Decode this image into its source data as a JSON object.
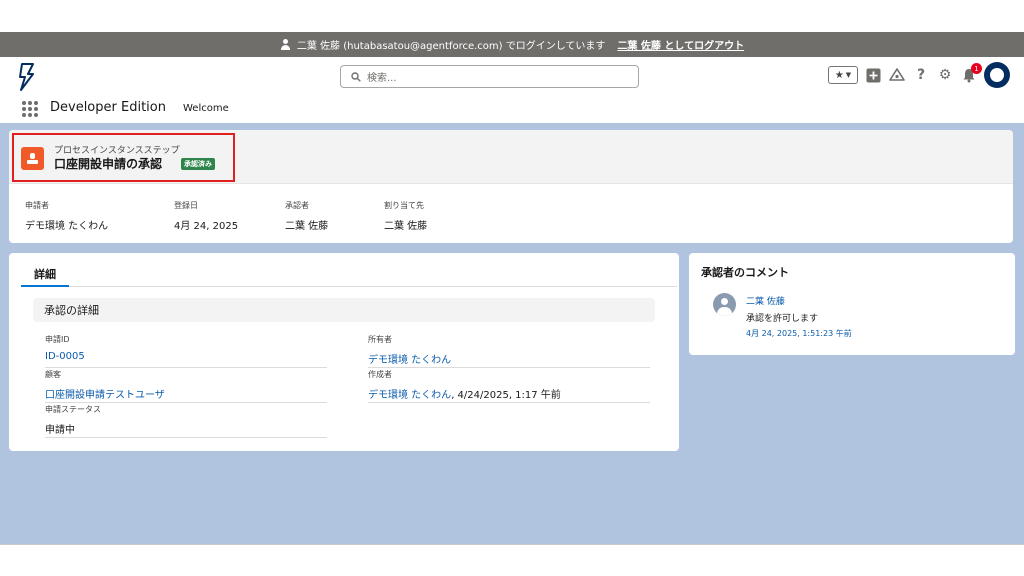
{
  "login_bar": {
    "message": "二葉 佐藤 (hutabasatou@agentforce.com) でログインしています",
    "logout_link": "二葉 佐藤 としてログアウト"
  },
  "header": {
    "search_placeholder": "検索...",
    "notification_count": "1"
  },
  "app_nav": {
    "app_name": "Developer Edition",
    "items": [
      "Welcome"
    ]
  },
  "record": {
    "object_type": "プロセスインスタンスステップ",
    "title": "口座開設申請の承認",
    "status_badge": "承認済み",
    "highlights": [
      {
        "label": "申請者",
        "value": "デモ環境 たくわん"
      },
      {
        "label": "登録日",
        "value": "4月 24, 2025"
      },
      {
        "label": "承認者",
        "value": "二葉 佐藤"
      },
      {
        "label": "割り当て先",
        "value": "二葉 佐藤"
      }
    ]
  },
  "details": {
    "tab_label": "詳細",
    "section_title": "承認の詳細",
    "fields": {
      "request_id": {
        "label": "申請ID",
        "value": "ID-0005"
      },
      "owner": {
        "label": "所有者",
        "value": "デモ環境 たくわん"
      },
      "customer": {
        "label": "顧客",
        "value": "口座開設申請テストユーザ"
      },
      "created_by": {
        "label": "作成者",
        "value": "デモ環境 たくわん",
        "suffix": ", 4/24/2025, 1:17 午前"
      },
      "request_status": {
        "label": "申請ステータス",
        "value": "申請中"
      }
    }
  },
  "comments": {
    "title": "承認者のコメント",
    "items": [
      {
        "author": "二葉 佐藤",
        "text": "承認を許可します",
        "date": "4月 24, 2025, 1:51:23 午前"
      }
    ]
  },
  "colors": {
    "brand_blue": "#0176d3",
    "link_blue": "#0b5cab",
    "record_icon": "#f05a28",
    "approved_green": "#2e844a",
    "highlight_border": "#e02020",
    "content_background": "#b0c4df"
  }
}
